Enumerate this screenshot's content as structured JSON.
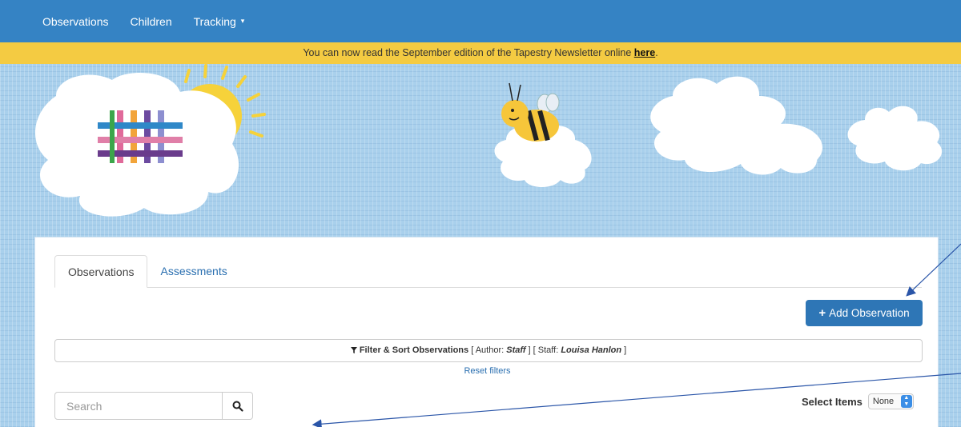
{
  "nav": {
    "items": [
      {
        "label": "Observations"
      },
      {
        "label": "Children"
      },
      {
        "label": "Tracking"
      }
    ],
    "tracking_caret": "▾"
  },
  "banner": {
    "text": "You can now read the September edition of the Tapestry Newsletter online ",
    "link": "here",
    "suffix": "."
  },
  "tabs": [
    {
      "label": "Observations",
      "active": true
    },
    {
      "label": "Assessments",
      "active": false
    }
  ],
  "add_button": {
    "label": "Add Observation",
    "icon": "plus-icon"
  },
  "filter": {
    "icon": "filter-icon",
    "title": "Filter & Sort Observations",
    "author_label": "Author:",
    "author_value": "Staff",
    "staff_label": "Staff:",
    "staff_value": "Louisa Hanlon"
  },
  "reset_label": "Reset filters",
  "search": {
    "placeholder": "Search",
    "value": "",
    "icon": "search-icon"
  },
  "select_items": {
    "label": "Select Items",
    "selected": "None"
  },
  "colors": {
    "navbar": "#3583c4",
    "banner": "#f4cb42",
    "primary_button": "#2e76b6",
    "link": "#2a6fb0",
    "sky": "#a9d0ec"
  }
}
